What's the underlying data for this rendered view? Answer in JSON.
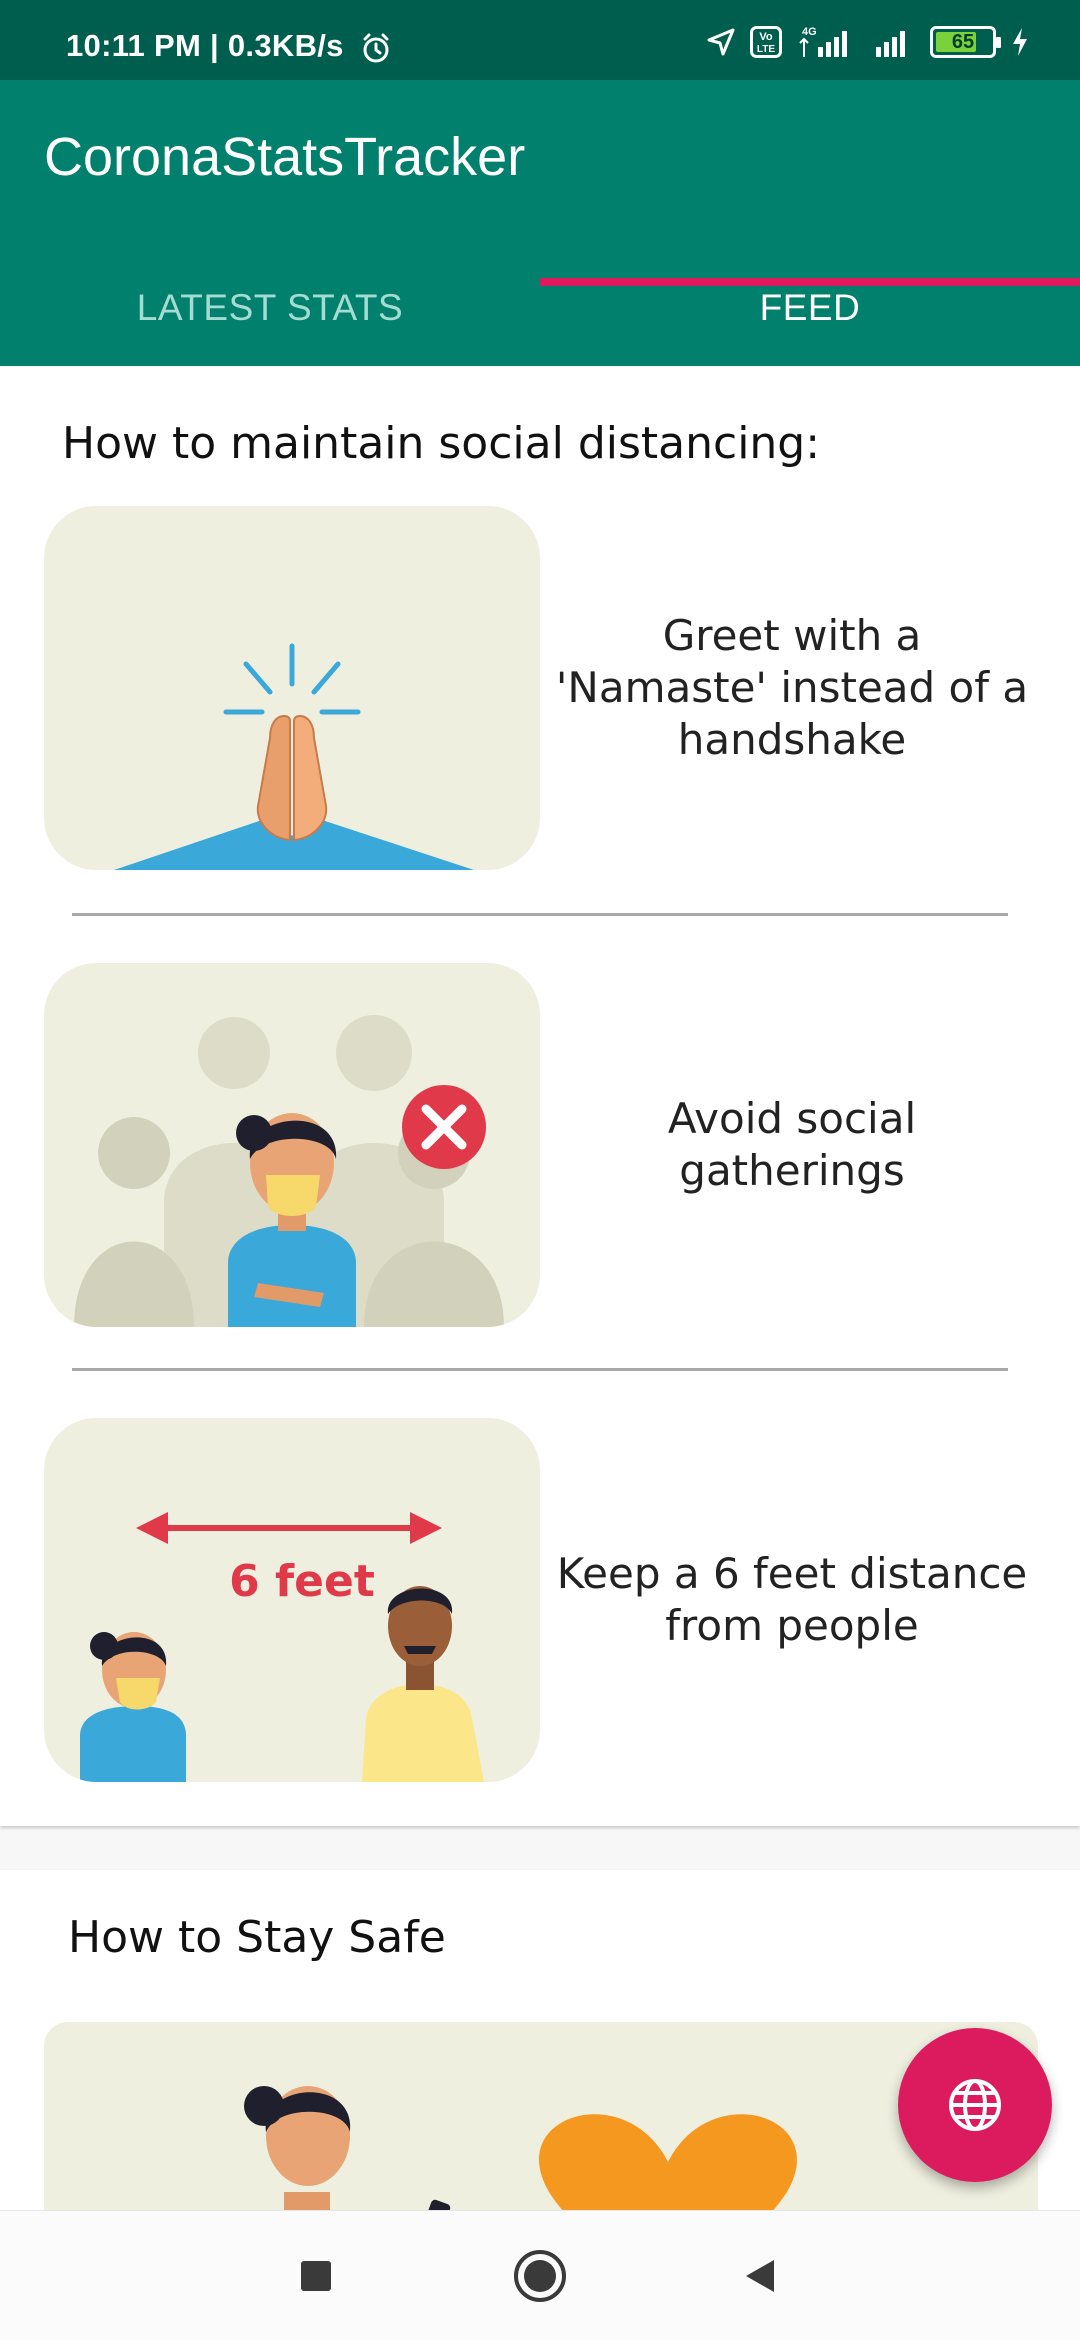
{
  "status_bar": {
    "time": "10:11 PM | 0.3KB/s",
    "battery": "65",
    "battery_level": 0.65,
    "network": "4G",
    "volte": "Vo LTE",
    "icons": [
      "alarm-icon",
      "location-icon",
      "volte-icon",
      "signal-icon",
      "signal-icon",
      "battery-icon",
      "charging-icon"
    ]
  },
  "app": {
    "title": "CoronaStatsTracker",
    "tabs": [
      {
        "label": "LATEST STATS",
        "selected": false
      },
      {
        "label": "FEED",
        "selected": true
      }
    ]
  },
  "social_distancing": {
    "title": "How to maintain social distancing:",
    "tips": [
      {
        "text": "Greet with a 'Namaste' instead of a handshake",
        "image": "namaste-illustration"
      },
      {
        "text": "Avoid social gatherings",
        "image": "avoid-gatherings-illustration"
      },
      {
        "text": "Keep a 6 feet distance from people",
        "image": "six-feet-distance-illustration",
        "image_label": "6 feet"
      }
    ]
  },
  "stay_safe": {
    "title": "How to Stay Safe"
  },
  "fab": {
    "icon": "globe-icon"
  },
  "nav": {
    "icons": [
      "recents-icon",
      "home-icon",
      "back-icon"
    ]
  },
  "colors": {
    "status_bar": "#005e4e",
    "app_bar": "#00806d",
    "accent": "#e0195f",
    "fab": "#dc1b5e",
    "illustration_bg": "#efefe0"
  }
}
